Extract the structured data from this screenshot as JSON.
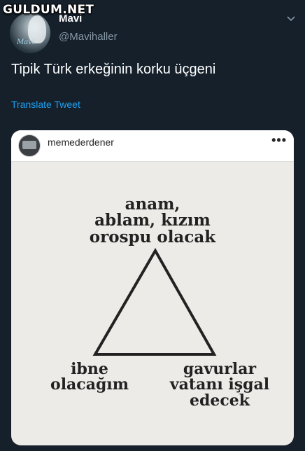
{
  "watermark": "GULDUM.NET",
  "tweet": {
    "display_name": "Mavi",
    "handle": "@Mavihaller",
    "text": "Tipik Türk erkeğinin korku üçgeni",
    "translate_label": "Translate Tweet",
    "avatar_text": "Mavi"
  },
  "media": {
    "instagram_username": "memederdener",
    "more_label": "•••",
    "meme": {
      "top": "anam,\nablam, kızım\norospu olacak",
      "bottom_left": "ibne\nolacağım",
      "bottom_right": "gavurlar\nvatanı işgal\nedecek"
    }
  },
  "colors": {
    "background": "#15202b",
    "link": "#1da1f2",
    "secondary_text": "#8899a6",
    "meme_background": "#ecebe7"
  }
}
